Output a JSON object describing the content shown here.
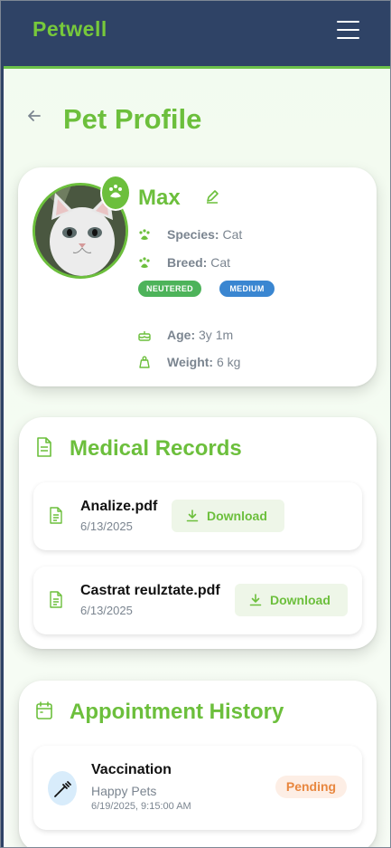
{
  "navbar": {
    "brand": "Petwell",
    "menu_icon": "hamburger-icon"
  },
  "page": {
    "title": "Pet Profile",
    "back_icon": "arrow-left-icon"
  },
  "pet": {
    "name": "Max",
    "species_label": "Species:",
    "species": "Cat",
    "breed_label": "Breed:",
    "breed": "Cat",
    "tags": [
      "NEUTERED",
      "MEDIUM"
    ],
    "age_label": "Age:",
    "age": "3y 1m",
    "weight_label": "Weight:",
    "weight": "6 kg"
  },
  "medical_records": {
    "title": "Medical Records",
    "items": [
      {
        "name": "Analize.pdf",
        "date": "6/13/2025",
        "action": "Download"
      },
      {
        "name": "Castrat reulztate.pdf",
        "date": "6/13/2025",
        "action": "Download"
      }
    ]
  },
  "appointment_history": {
    "title": "Appointment History",
    "items": [
      {
        "title": "Vaccination",
        "clinic": "Happy Pets",
        "datetime": "6/19/2025, 9:15:00 AM",
        "status": "Pending"
      }
    ]
  },
  "colors": {
    "brand_green": "#6cbf3c",
    "navbar": "#2f4366",
    "neutered_tag": "#4db35a",
    "medium_tag": "#3a86d1",
    "pending_text": "#e8873f",
    "pending_bg": "#fdeee5"
  }
}
